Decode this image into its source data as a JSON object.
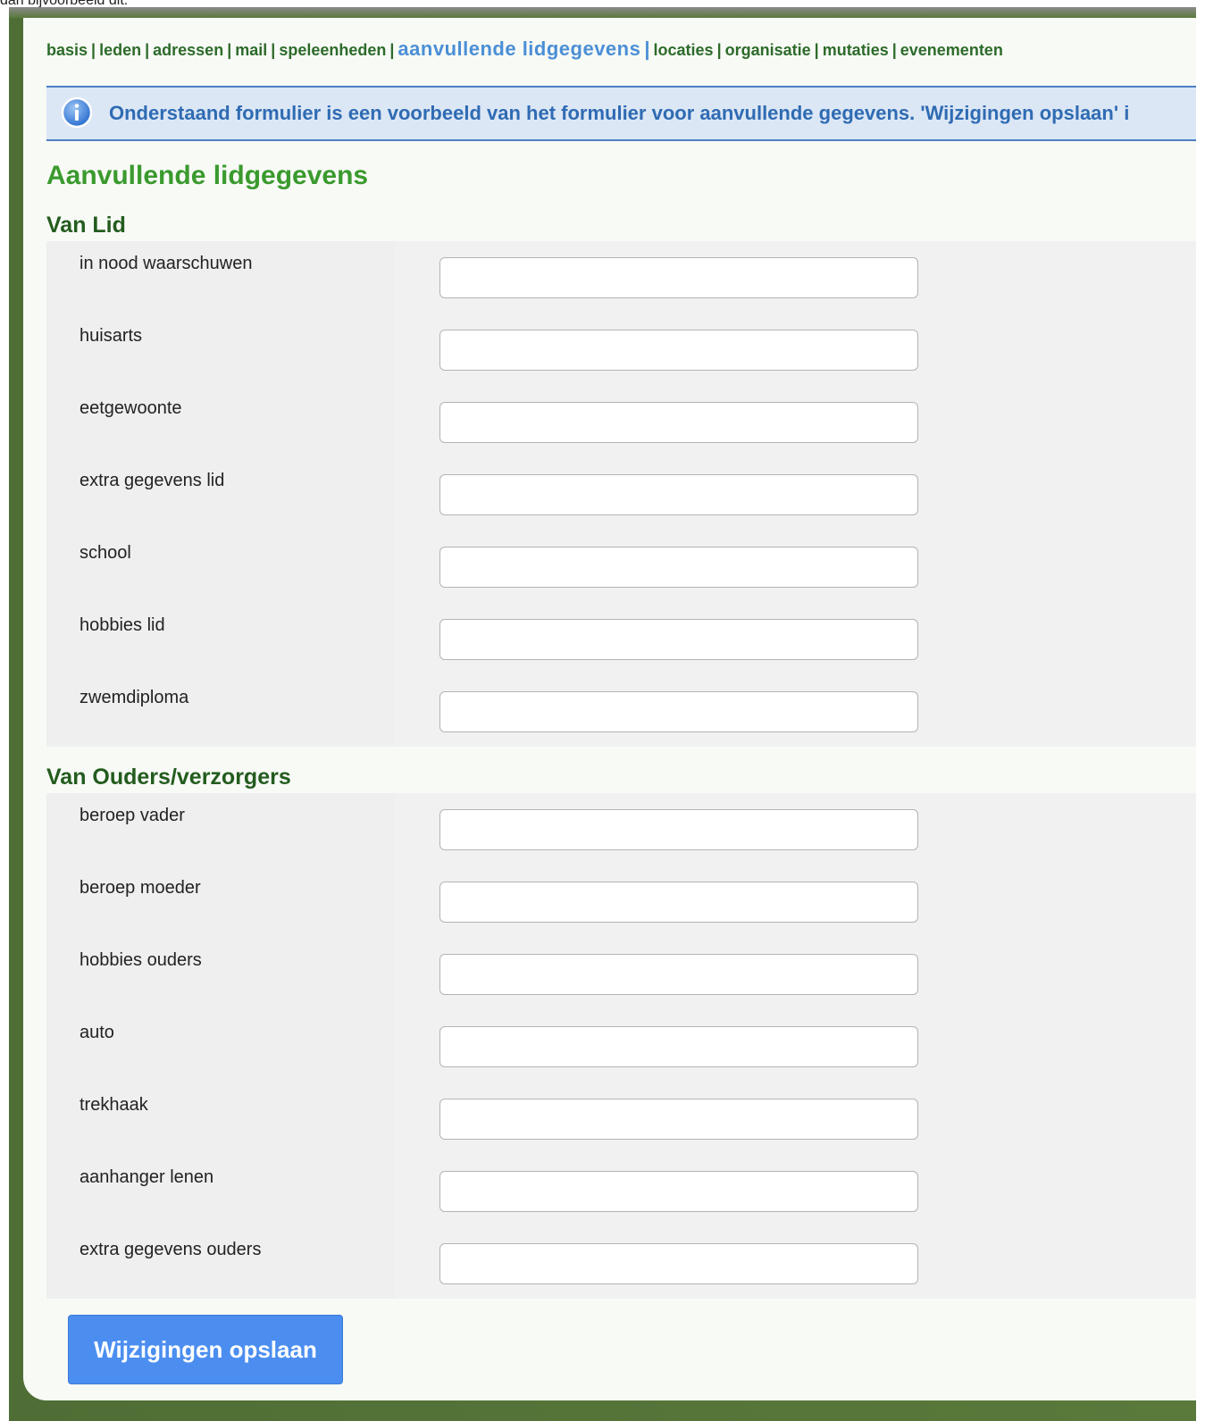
{
  "caption": "dan bijvoorbeeld dit:",
  "nav": {
    "items": [
      {
        "label": "basis"
      },
      {
        "label": "leden"
      },
      {
        "label": "adressen"
      },
      {
        "label": "mail"
      },
      {
        "label": "speleenheden"
      },
      {
        "label": "aanvullende lidgegevens",
        "active": true
      },
      {
        "label": "locaties"
      },
      {
        "label": "organisatie"
      },
      {
        "label": "mutaties"
      },
      {
        "label": "evenementen"
      }
    ],
    "separator": "|"
  },
  "info": {
    "icon": "info-icon",
    "text": "Onderstaand formulier is een voorbeeld van het formulier voor aanvullende gegevens. 'Wijzigingen opslaan' i"
  },
  "page_title": "Aanvullende lidgegevens",
  "sections": [
    {
      "title": "Van Lid",
      "fields": [
        {
          "label": "in nood waarschuwen",
          "value": ""
        },
        {
          "label": "huisarts",
          "value": ""
        },
        {
          "label": "eetgewoonte",
          "value": ""
        },
        {
          "label": "extra gegevens lid",
          "value": ""
        },
        {
          "label": "school",
          "value": ""
        },
        {
          "label": "hobbies lid",
          "value": ""
        },
        {
          "label": "zwemdiploma",
          "value": ""
        }
      ]
    },
    {
      "title": "Van Ouders/verzorgers",
      "fields": [
        {
          "label": "beroep vader",
          "value": ""
        },
        {
          "label": "beroep moeder",
          "value": ""
        },
        {
          "label": "hobbies ouders",
          "value": ""
        },
        {
          "label": "auto",
          "value": ""
        },
        {
          "label": "trekhaak",
          "value": ""
        },
        {
          "label": "aanhanger lenen",
          "value": ""
        },
        {
          "label": "extra gegevens ouders",
          "value": ""
        }
      ]
    }
  ],
  "save_button": "Wijzigingen opslaan",
  "colors": {
    "frame_green": "#5a7a3c",
    "nav_green": "#2d6b2a",
    "active_blue": "#4b8fd6",
    "title_green": "#3a9a2e",
    "button_blue": "#4b8ef0"
  }
}
